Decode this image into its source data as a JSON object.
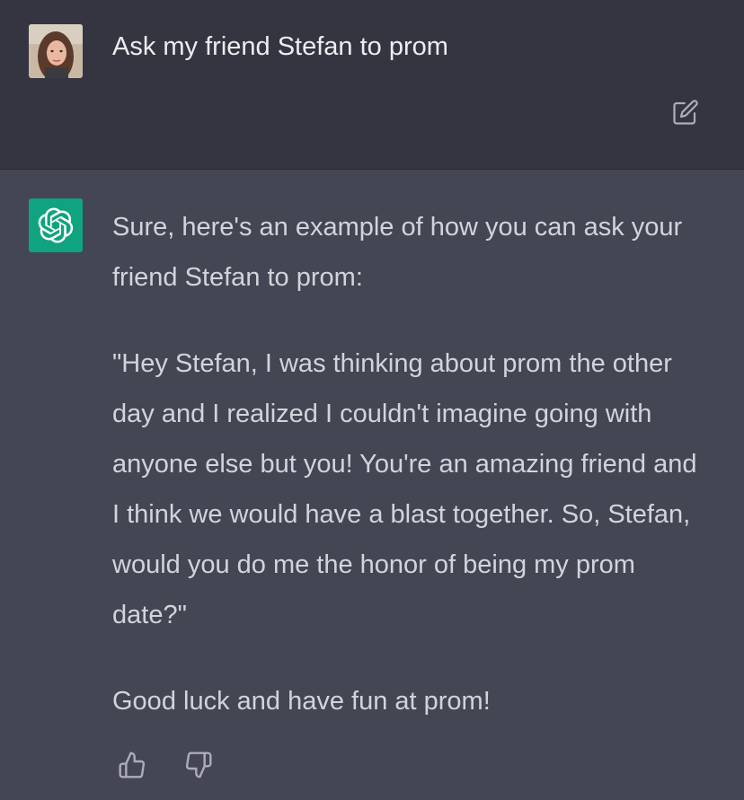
{
  "conversation": {
    "user_message": {
      "text": "Ask my friend Stefan to prom",
      "avatar_icon": "user-photo-avatar",
      "edit_icon": "edit-icon"
    },
    "assistant_message": {
      "avatar_icon": "openai-logo-icon",
      "paragraphs": [
        "Sure, here's an example of how you can ask your friend Stefan to prom:",
        "\"Hey Stefan, I was thinking about prom the other day and I realized I couldn't imagine going with anyone else but you! You're an amazing friend and I think we would have a blast together. So, Stefan, would you do me the honor of being my prom date?\"",
        "Good luck and have fun at prom!"
      ],
      "feedback": {
        "like_icon": "thumbs-up-icon",
        "dislike_icon": "thumbs-down-icon"
      }
    }
  },
  "colors": {
    "user_bg": "#343541",
    "assistant_bg": "#444654",
    "text": "#d1d5db",
    "brand_green": "#10a37f"
  }
}
